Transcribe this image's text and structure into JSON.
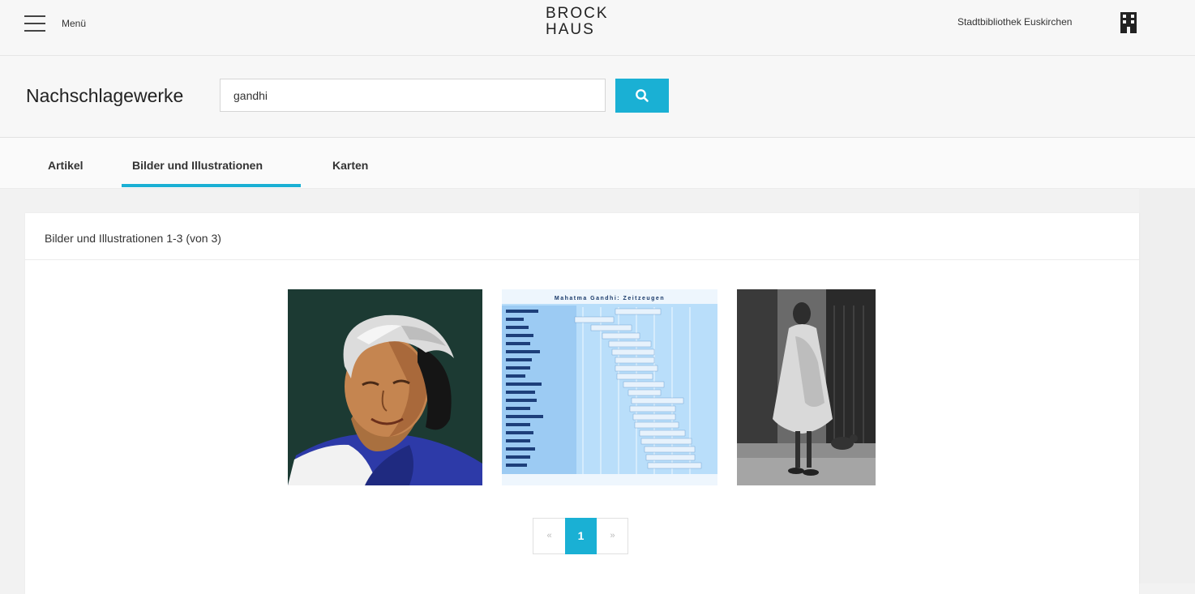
{
  "header": {
    "menu_label": "Menü",
    "logo_line1": "BROCK",
    "logo_line2": "HAUS",
    "library_name": "Stadtbibliothek Euskirchen",
    "building_icon": "building-icon"
  },
  "search": {
    "title": "Nachschlagewerke",
    "value": "gandhi",
    "button_icon": "search-icon"
  },
  "tabs": [
    {
      "label": "Artikel",
      "active": false
    },
    {
      "label": "Bilder und Illustrationen",
      "active": true
    },
    {
      "label": "Karten",
      "active": false
    }
  ],
  "results": {
    "count_label": "Bilder und Illustrationen 1-3 (von 3)",
    "images": [
      {
        "subject": "portrait-illustration"
      },
      {
        "subject": "timeline-chart",
        "title": "Mahatma Gandhi: Zeitzeugen"
      },
      {
        "subject": "photo-gandhi"
      }
    ]
  },
  "pagination": {
    "prev": "«",
    "current": "1",
    "next": "»"
  },
  "colors": {
    "accent": "#1ab0d4",
    "portrait_background": "#1c3a33",
    "timeline_background": "#b9defa"
  }
}
